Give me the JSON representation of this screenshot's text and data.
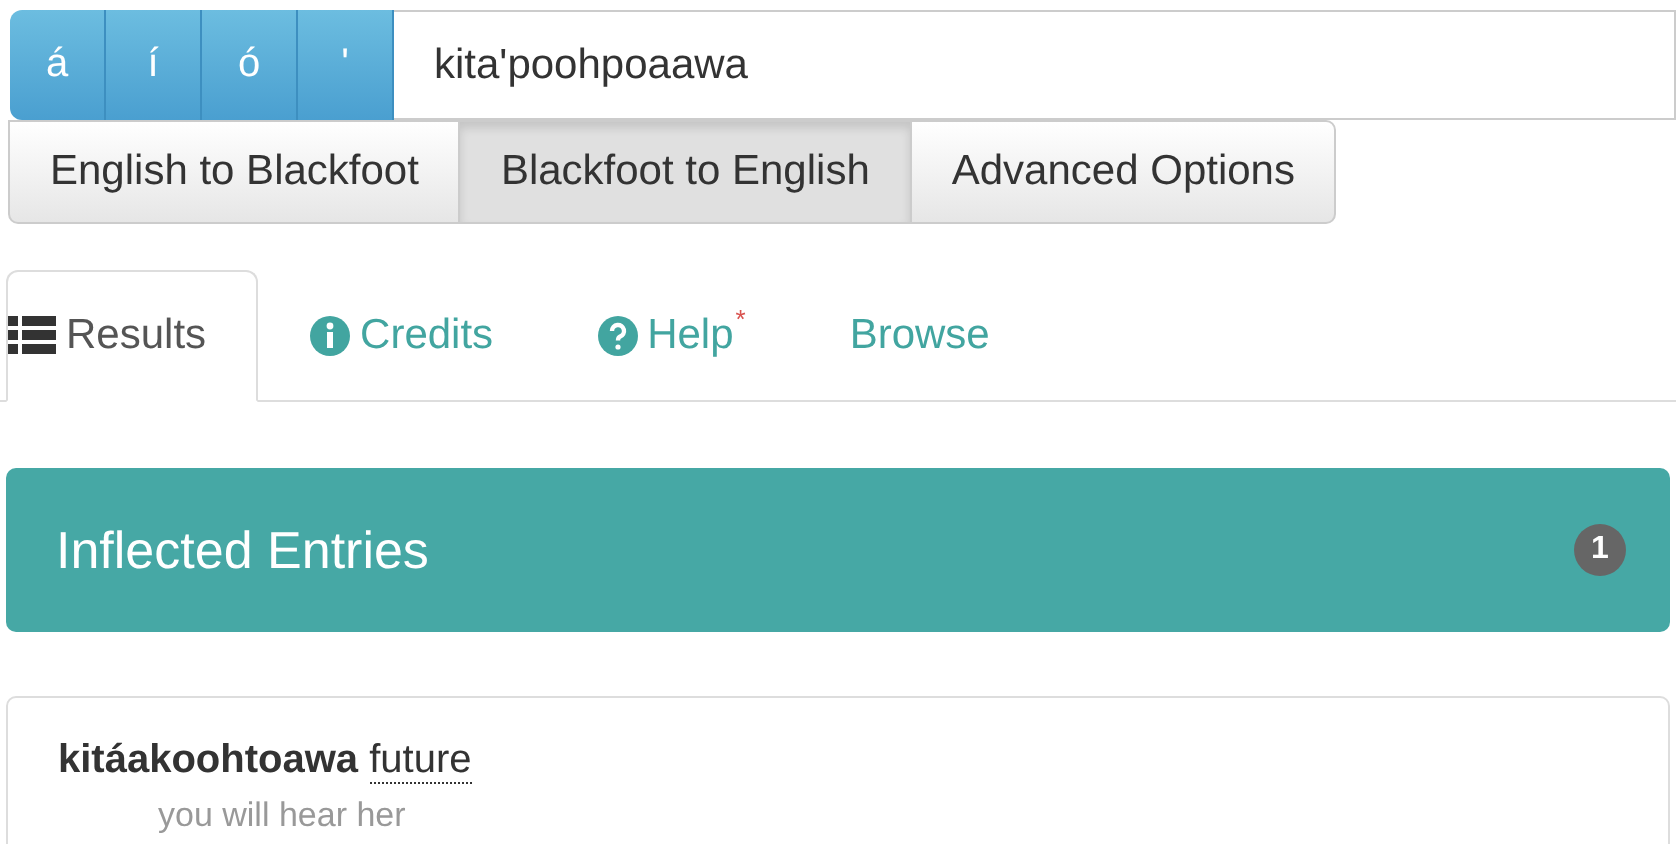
{
  "search": {
    "accent_keys": [
      "á",
      "í",
      "ó",
      "'"
    ],
    "value": "kita'poohpoaawa"
  },
  "modes": [
    {
      "label": "English to Blackfoot",
      "selected": false
    },
    {
      "label": "Blackfoot to English",
      "selected": true
    },
    {
      "label": "Advanced Options",
      "selected": false
    }
  ],
  "tabs": [
    {
      "label": "Results",
      "kind": "list",
      "selected": true
    },
    {
      "label": "Credits",
      "kind": "info",
      "selected": false
    },
    {
      "label": "Help",
      "kind": "question",
      "marker": "*",
      "selected": false
    },
    {
      "label": "Browse",
      "kind": "plain",
      "selected": false
    }
  ],
  "panel": {
    "title": "Inflected Entries",
    "count": "1"
  },
  "entries": [
    {
      "word": "kitáakoohtoawa",
      "tag": "future",
      "gloss": "you will hear her"
    }
  ]
}
